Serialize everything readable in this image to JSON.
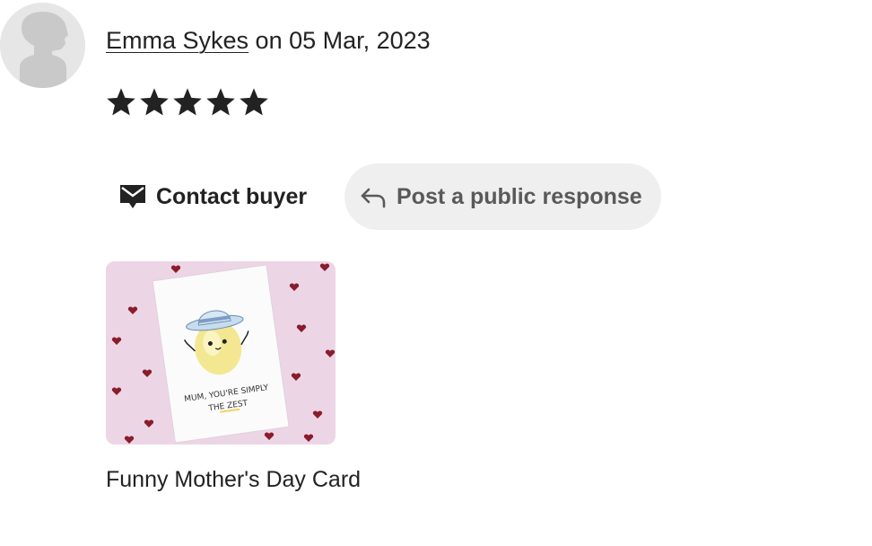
{
  "review": {
    "reviewer_name": "Emma Sykes",
    "date_text": " on 05 Mar, 2023",
    "rating": 5,
    "rating_max": 5
  },
  "actions": {
    "contact_label": "Contact buyer",
    "respond_label": "Post a public response"
  },
  "product": {
    "card_line1": "MUM, YOU'RE SIMPLY",
    "card_line2": "THE ZEST",
    "title": "Funny Mother's Day Card"
  },
  "icons": {
    "avatar": "default-avatar-icon",
    "star": "star-icon",
    "contact": "mail-icon",
    "respond": "reply-arrow-icon"
  },
  "colors": {
    "star": "#222222",
    "respond_bg": "#efefef",
    "respond_text": "#595959",
    "image_bg": "#ecd6e6",
    "heart": "#8a1c2b"
  }
}
